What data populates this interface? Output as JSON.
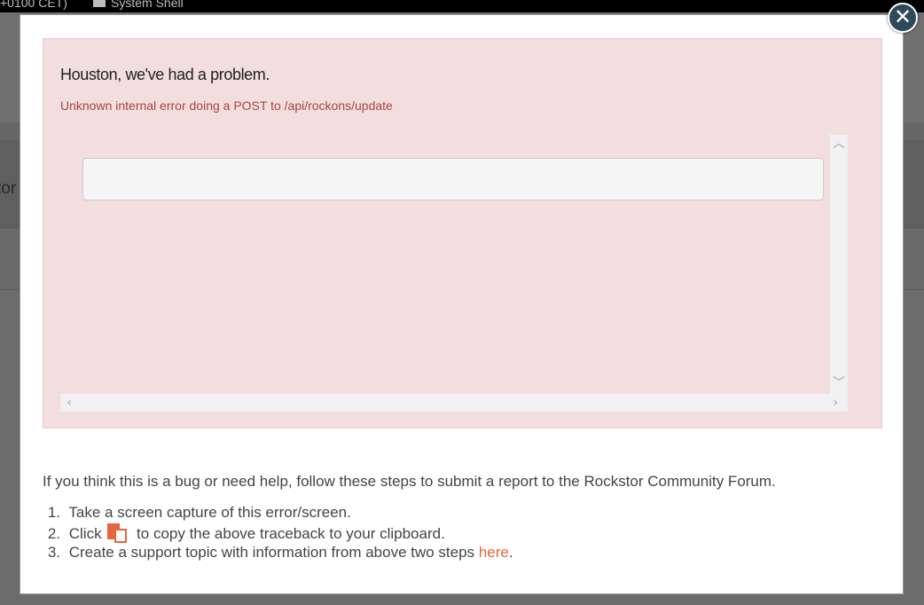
{
  "background": {
    "topbar_left": "+0100 CET)",
    "topbar_item": "System Shell",
    "side_fragment": "tor"
  },
  "modal": {
    "close_icon": "close-circle-icon",
    "close_glyph": "✕",
    "alert": {
      "title": "Houston, we've had a problem.",
      "message": "Unknown internal error doing a POST to /api/rockons/update",
      "traceback": ""
    },
    "help": {
      "intro": "If you think this is a bug or need help, follow these steps to submit a report to the Rockstor Community Forum.",
      "step1_num": "1.",
      "step1": "Take a screen capture of this error/screen.",
      "step2_num": "2.",
      "step2_pre": "Click",
      "step2_icon": "copy-clipboard-icon",
      "step2_post": "to copy the above traceback to your clipboard.",
      "step3_num": "3.",
      "step3_pre": "Create a support topic with information from above two steps",
      "step3_link": "here",
      "step3_post": "."
    },
    "colors": {
      "alert_bg": "#f2dede",
      "alert_text": "#a94442",
      "accent": "#e8643c"
    }
  }
}
